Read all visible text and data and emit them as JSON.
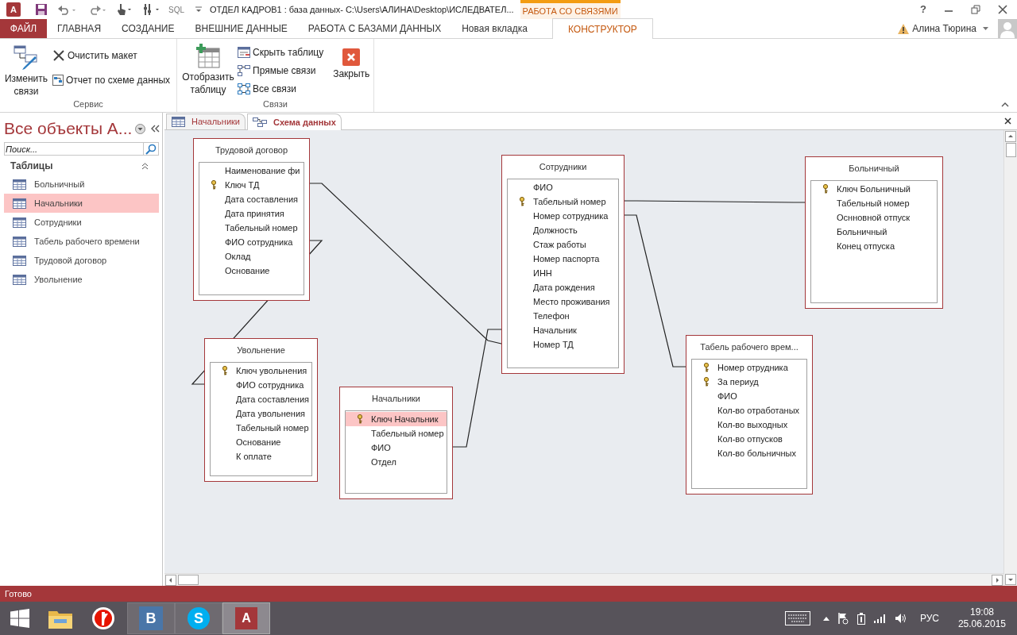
{
  "title_bar": {
    "app_icon_letter": "A",
    "sql_label": "SQL",
    "title": "ОТДЕЛ КАДРОВ1 : база данных- C:\\Users\\АЛИНА\\Desktop\\ИСЛЕДВАТЕЛ...",
    "context_group": "РАБОТА СО СВЯЗЯМИ",
    "help": "?"
  },
  "ribbon_tabs": [
    {
      "label": "ФАЙЛ",
      "kind": "file",
      "selected": false
    },
    {
      "label": "ГЛАВНАЯ",
      "kind": "normal",
      "selected": false
    },
    {
      "label": "СОЗДАНИЕ",
      "kind": "normal",
      "selected": false
    },
    {
      "label": "ВНЕШНИЕ ДАННЫЕ",
      "kind": "normal",
      "selected": false
    },
    {
      "label": "РАБОТА С БАЗАМИ ДАННЫХ",
      "kind": "normal",
      "selected": false
    },
    {
      "label": "Новая вкладка",
      "kind": "normal",
      "selected": false
    },
    {
      "label": "КОНСТРУКТОР",
      "kind": "context",
      "selected": true
    }
  ],
  "user": {
    "name": "Алина Тюрина"
  },
  "ribbon_groups": [
    {
      "label": "Сервис",
      "buttons": [
        {
          "label": "Изменить связи",
          "kind": "edit"
        },
        {
          "label": "Очистить макет",
          "kind": "clear"
        },
        {
          "label": "Отчет по схеме данных",
          "kind": "report"
        }
      ]
    },
    {
      "label": "Связи",
      "buttons": [
        {
          "label": "Отобразить таблицу",
          "kind": "show"
        },
        {
          "label": "Скрыть таблицу",
          "kind": "hide"
        },
        {
          "label": "Прямые связи",
          "kind": "direct"
        },
        {
          "label": "Все связи",
          "kind": "all"
        },
        {
          "label": "Закрыть",
          "kind": "close"
        }
      ]
    }
  ],
  "nav_pane": {
    "title": "Все объекты A...",
    "search_placeholder": "Поиск...",
    "section": "Таблицы",
    "items": [
      {
        "label": "Больничный",
        "selected": false
      },
      {
        "label": "Начальники",
        "selected": true
      },
      {
        "label": "Сотрудники",
        "selected": false
      },
      {
        "label": "Табель рабочего времени",
        "selected": false
      },
      {
        "label": "Трудовой договор",
        "selected": false
      },
      {
        "label": "Увольнение",
        "selected": false
      }
    ]
  },
  "document_tabs": [
    {
      "label": "Начальники",
      "kind": "table",
      "selected": false
    },
    {
      "label": "Схема данных",
      "kind": "diagram",
      "selected": true
    }
  ],
  "diagram_tables": [
    {
      "name": "Трудовой договор",
      "fields": [
        {
          "name": "Наименование фи",
          "key": false,
          "selected": false
        },
        {
          "name": "Ключ ТД",
          "key": true,
          "selected": false
        },
        {
          "name": "Дата составления",
          "key": false,
          "selected": false
        },
        {
          "name": "Дата принятия",
          "key": false,
          "selected": false
        },
        {
          "name": "Табельный номер",
          "key": false,
          "selected": false
        },
        {
          "name": "ФИО сотрудника",
          "key": false,
          "selected": false
        },
        {
          "name": "Оклад",
          "key": false,
          "selected": false
        },
        {
          "name": "Основание",
          "key": false,
          "selected": false
        }
      ]
    },
    {
      "name": "Сотрудники",
      "fields": [
        {
          "name": "ФИО",
          "key": false,
          "selected": false
        },
        {
          "name": "Табельный номер",
          "key": true,
          "selected": false
        },
        {
          "name": "Номер сотрудника",
          "key": false,
          "selected": false
        },
        {
          "name": "Должность",
          "key": false,
          "selected": false
        },
        {
          "name": "Стаж работы",
          "key": false,
          "selected": false
        },
        {
          "name": "Номер паспорта",
          "key": false,
          "selected": false
        },
        {
          "name": "ИНН",
          "key": false,
          "selected": false
        },
        {
          "name": "Дата рождения",
          "key": false,
          "selected": false
        },
        {
          "name": "Место проживания",
          "key": false,
          "selected": false
        },
        {
          "name": "Телефон",
          "key": false,
          "selected": false
        },
        {
          "name": "Начальник",
          "key": false,
          "selected": false
        },
        {
          "name": "Номер ТД",
          "key": false,
          "selected": false
        }
      ]
    },
    {
      "name": "Больничный",
      "fields": [
        {
          "name": "Ключ Больничный",
          "key": true,
          "selected": false
        },
        {
          "name": "Табельный номер",
          "key": false,
          "selected": false
        },
        {
          "name": "Оснновной отпуск",
          "key": false,
          "selected": false
        },
        {
          "name": "Больничный",
          "key": false,
          "selected": false
        },
        {
          "name": "Конец отпуска",
          "key": false,
          "selected": false
        }
      ]
    },
    {
      "name": "Увольнение",
      "fields": [
        {
          "name": "Ключ увольнения",
          "key": true,
          "selected": false
        },
        {
          "name": "ФИО сотрудника",
          "key": false,
          "selected": false
        },
        {
          "name": "Дата составления",
          "key": false,
          "selected": false
        },
        {
          "name": "Дата увольнения",
          "key": false,
          "selected": false
        },
        {
          "name": "Табельный номер",
          "key": false,
          "selected": false
        },
        {
          "name": "Основание",
          "key": false,
          "selected": false
        },
        {
          "name": "К оплате",
          "key": false,
          "selected": false
        }
      ]
    },
    {
      "name": "Начальники",
      "fields": [
        {
          "name": "Ключ Начальник",
          "key": true,
          "selected": true
        },
        {
          "name": "Табельный номер",
          "key": false,
          "selected": false
        },
        {
          "name": "ФИО",
          "key": false,
          "selected": false
        },
        {
          "name": "Отдел",
          "key": false,
          "selected": false
        }
      ]
    },
    {
      "name": "Табель рабочего врем...",
      "fields": [
        {
          "name": "Номер отрудника",
          "key": true,
          "selected": false
        },
        {
          "name": "За периуд",
          "key": true,
          "selected": false
        },
        {
          "name": "ФИО",
          "key": false,
          "selected": false
        },
        {
          "name": "Кол-во отработаных",
          "key": false,
          "selected": false
        },
        {
          "name": "Кол-во выходных",
          "key": false,
          "selected": false
        },
        {
          "name": "Кол-во отпусков",
          "key": false,
          "selected": false
        },
        {
          "name": "Кол-во больничных",
          "key": false,
          "selected": false
        }
      ]
    }
  ],
  "status_bar": {
    "text": "Готово"
  },
  "taskbar": {
    "apps": [
      {
        "kind": "explorer",
        "open": false,
        "selected": false
      },
      {
        "kind": "browser",
        "open": false,
        "selected": false
      },
      {
        "kind": "vk",
        "letter": "B",
        "open": true,
        "selected": false
      },
      {
        "kind": "skype",
        "letter": "S",
        "open": true,
        "selected": false
      },
      {
        "kind": "access",
        "letter": "A",
        "open": true,
        "selected": true
      }
    ],
    "language": "РУС",
    "time": "19:08",
    "date": "25.06.2015"
  }
}
